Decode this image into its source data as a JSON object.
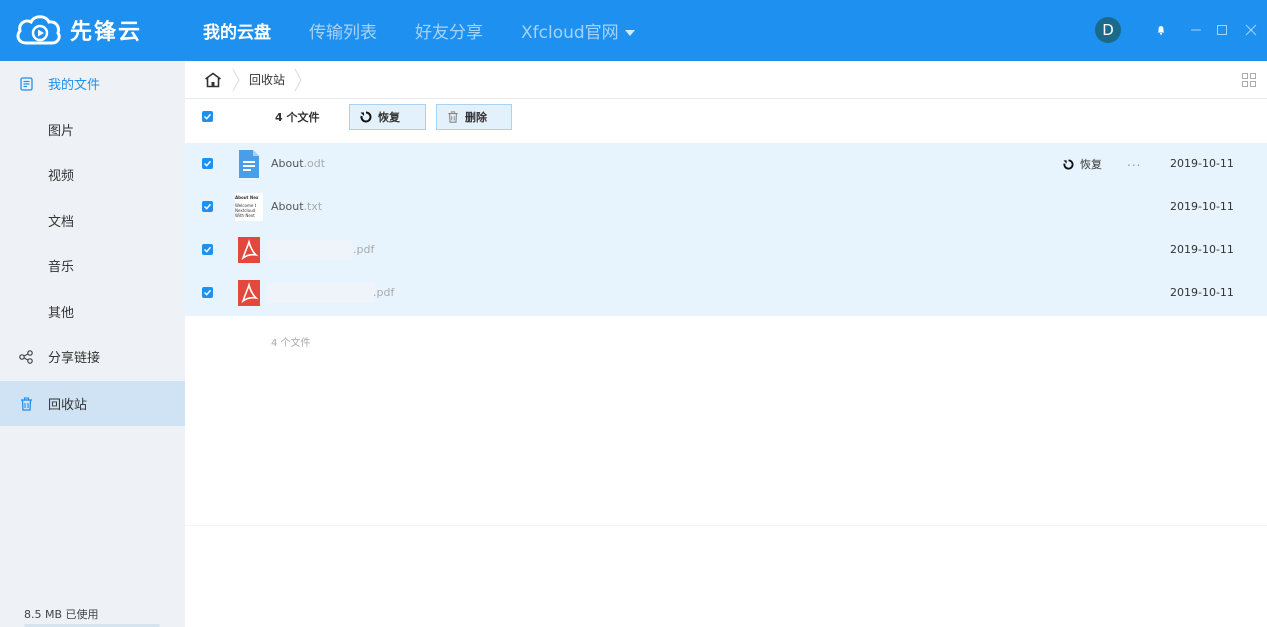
{
  "app": {
    "logo_text": "先锋云",
    "avatar_letter": "D"
  },
  "nav": {
    "items": [
      {
        "label": "我的云盘",
        "active": true
      },
      {
        "label": "传输列表",
        "active": false
      },
      {
        "label": "好友分享",
        "active": false
      },
      {
        "label": "Xfcloud官网",
        "active": false
      }
    ]
  },
  "sidebar": {
    "items": [
      {
        "label": "我的文件",
        "icon": "file-list-icon"
      },
      {
        "label": "图片"
      },
      {
        "label": "视频"
      },
      {
        "label": "文档"
      },
      {
        "label": "音乐"
      },
      {
        "label": "其他"
      },
      {
        "label": "分享链接",
        "icon": "share-icon"
      },
      {
        "label": "回收站",
        "icon": "trash-icon",
        "active": true
      }
    ],
    "storage_used": "8.5 MB 已使用"
  },
  "breadcrumb": {
    "current": "回收站"
  },
  "toolbar": {
    "count": "4 个文件",
    "restore_label": "恢复",
    "delete_label": "删除"
  },
  "files": [
    {
      "name": "About",
      "ext": ".odt",
      "date": "2019-10-11",
      "icon": "document-icon",
      "hover": true
    },
    {
      "name": "About",
      "ext": ".txt",
      "date": "2019-10-11",
      "icon": "text-thumbnail-icon"
    },
    {
      "name": "",
      "ext": ".pdf",
      "date": "2019-10-11",
      "icon": "pdf-icon"
    },
    {
      "name": "",
      "ext": ".pdf",
      "date": "2019-10-11",
      "icon": "pdf-icon"
    }
  ],
  "row_actions": {
    "restore_label": "恢复",
    "more_label": "..."
  },
  "footer": {
    "count": "4 个文件"
  },
  "thumbnail_text": {
    "line1": "About Nex",
    "line2": "Welcome t",
    "line3": "Nextcloud",
    "line4": "With Next"
  },
  "colors": {
    "accent": "#1e90ef",
    "pdf_red": "#e2483b",
    "doc_blue": "#4a9ee8"
  }
}
